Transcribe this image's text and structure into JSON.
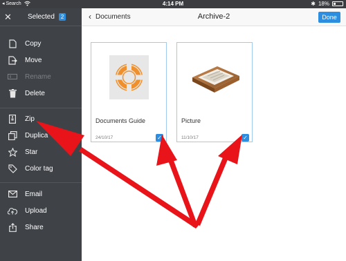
{
  "status_bar": {
    "back_label": "◂ Search",
    "time": "4:14 PM",
    "battery": "18%"
  },
  "sidebar": {
    "title": "Selected",
    "count": "2",
    "items": [
      {
        "label": "Copy",
        "icon": "copy-icon",
        "enabled": true
      },
      {
        "label": "Move",
        "icon": "move-icon",
        "enabled": true
      },
      {
        "label": "Rename",
        "icon": "rename-icon",
        "enabled": false
      },
      {
        "label": "Delete",
        "icon": "trash-icon",
        "enabled": true
      },
      {
        "label": "Zip",
        "icon": "zip-icon",
        "enabled": true
      },
      {
        "label": "Duplica",
        "icon": "duplicate-icon",
        "enabled": true
      },
      {
        "label": "Star",
        "icon": "star-icon",
        "enabled": true
      },
      {
        "label": "Color tag",
        "icon": "tag-icon",
        "enabled": true
      },
      {
        "label": "Email",
        "icon": "mail-icon",
        "enabled": true
      },
      {
        "label": "Upload",
        "icon": "upload-icon",
        "enabled": true
      },
      {
        "label": "Share",
        "icon": "share-icon",
        "enabled": true
      }
    ]
  },
  "navbar": {
    "back_label": "Documents",
    "title": "Archive-2",
    "done_label": "Done"
  },
  "files": [
    {
      "name": "Documents Guide",
      "date": "24/10/17",
      "selected": true,
      "icon": "lifebuoy-icon"
    },
    {
      "name": "Picture",
      "date": "11/10/17",
      "selected": true,
      "icon": "tray-icon"
    }
  ],
  "colors": {
    "sidebar_bg": "#3f4247",
    "accent": "#2d8ee0",
    "arrow": "#e8141a",
    "lifebuoy": "#f0902c"
  }
}
